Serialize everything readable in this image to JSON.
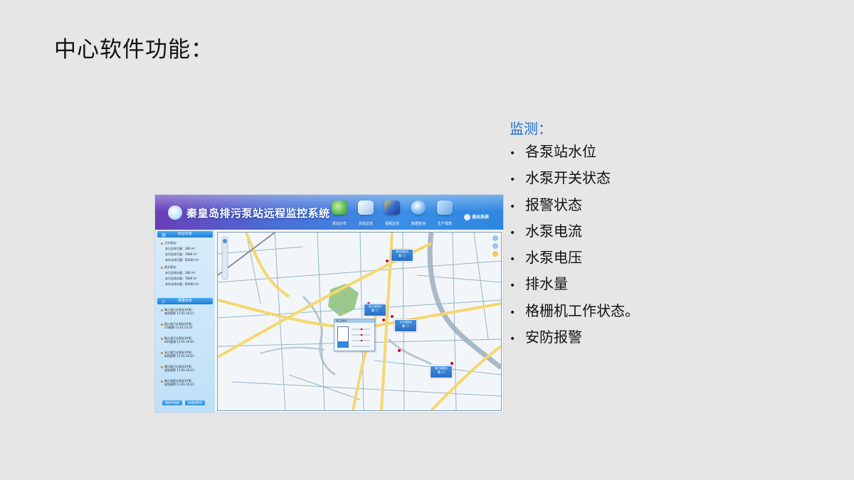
{
  "slide": {
    "title": "中心软件功能：",
    "monitor_heading": "监测：",
    "bullets": [
      "各泵站水位",
      "水泵开关状态",
      "报警状态",
      "水泵电流",
      "水泵电压",
      "排水量",
      "格栅机工作状态。",
      "安防报警"
    ]
  },
  "screenshot": {
    "app_title": "秦皇岛排污泵站远程监控系统",
    "nav": [
      {
        "label": "泵站分布",
        "icon": "map-distribution-icon",
        "color": "#4ab04a"
      },
      {
        "label": "状态总览",
        "icon": "status-overview-icon",
        "color": "#e0ecff"
      },
      {
        "label": "视频总览",
        "icon": "video-overview-icon",
        "color": "#3c6fd0"
      },
      {
        "label": "数据查询",
        "icon": "data-query-icon",
        "color": "#6fb4f0"
      },
      {
        "label": "生产报表",
        "icon": "production-report-icon",
        "color": "#62a7e8"
      }
    ],
    "exit_label": "退出系统",
    "summary": {
      "heading": "综合信息",
      "lines": [
        "污水泵站：",
        "本日总排污量：280 m³",
        "本月总排污量：7800 m³",
        "本年总排污量：85600 m³",
        "雨水泵站：",
        "本日总排水量：280 m³",
        "本月总排水量：7800 m³",
        "本年总排水量：85600 m³"
      ]
    },
    "alarms": {
      "heading": "报警信息",
      "items": [
        [
          "珠江道污水泵站1#泵：",
          "安防报警  11-01-16:21"
        ],
        [
          "珠江道污水泵站2#泵：",
          "CO故障  11-01-15:21"
        ],
        [
          "珠江道污水泵站3#泵：",
          "H2S超限  11-01-16:21"
        ],
        [
          "长江道污水泵站1#泵：",
          "安防报警  11-01-16:21"
        ],
        [
          "黄河道污水泵站1#泵：",
          "安防报警  11-01-16:21"
        ],
        [
          "珠江道雨水泵站1#泵：",
          "安防报警  11-01-16:21"
        ]
      ]
    },
    "panel_buttons": [
      "清除所有报",
      "选择报警项"
    ],
    "stations": [
      {
        "label": "黄河道泵站"
      },
      {
        "label": "珠江道泵站"
      },
      {
        "label": "长江道泵站"
      },
      {
        "label": "黄江道泵站"
      }
    ],
    "popup_title": "珠江道泵站"
  },
  "colors": {
    "title_blue": "#1f6cc4",
    "header_purple": "#6a3db7",
    "header_blue": "#2f86e0",
    "road_yellow": "#f5d76e",
    "green_park": "#9bc98b",
    "river": "#aab8c7",
    "alarm_dot": "#d0021b"
  }
}
